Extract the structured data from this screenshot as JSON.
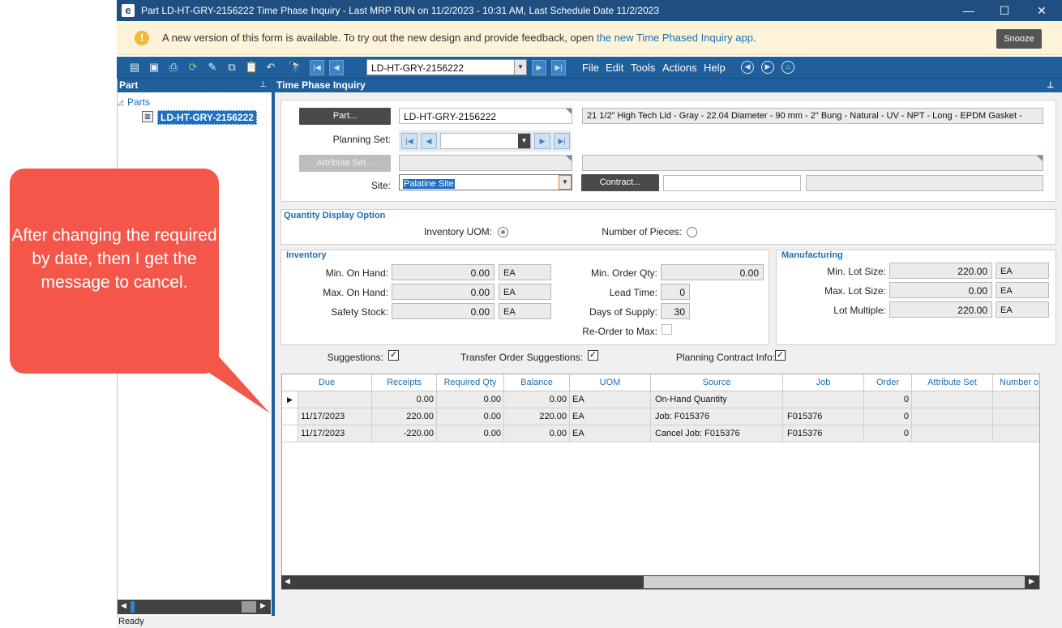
{
  "window": {
    "title": "Part LD-HT-GRY-2156222 Time Phase Inquiry  -  Last MRP RUN on 11/2/2023 - 10:31 AM, Last Schedule Date  11/2/2023",
    "logo": "e",
    "minimize": "—",
    "maximize": "☐",
    "close": "✕"
  },
  "notice": {
    "icon": "!",
    "text": "A new version of this form is available. To try out the new design and provide feedback, open ",
    "link": "the new Time Phased Inquiry app",
    "end": ".",
    "snooze": "Snooze"
  },
  "toolbar": {
    "part_value": "LD-HT-GRY-2156222",
    "menus": [
      "File",
      "Edit",
      "Tools",
      "Actions",
      "Help"
    ]
  },
  "left_panel": {
    "header": "Part",
    "tree_root": "Parts",
    "tree_node": "LD-HT-GRY-2156222"
  },
  "main": {
    "header": "Time Phase Inquiry",
    "part_button": "Part...",
    "part_value": "LD-HT-GRY-2156222",
    "part_description": "21 1/2\" High Tech Lid - Gray - 22.04 Diameter - 90 mm - 2\" Bung - Natural - UV - NPT - Long - EPDM Gasket -",
    "planning_set_label": "Planning Set:",
    "attribute_button": "Attribute Set...",
    "site_label": "Site:",
    "site_value": "Palatine Site",
    "contract_button": "Contract...",
    "qty_display": {
      "title": "Quantity Display Option",
      "inventory_uom": "Inventory UOM:",
      "number_of_pieces": "Number of Pieces:"
    },
    "inventory": {
      "title": "Inventory",
      "min_on_hand_label": "Min. On Hand:",
      "min_on_hand": "0.00",
      "min_on_hand_uom": "EA",
      "max_on_hand_label": "Max. On Hand:",
      "max_on_hand": "0.00",
      "max_on_hand_uom": "EA",
      "safety_stock_label": "Safety Stock:",
      "safety_stock": "0.00",
      "safety_stock_uom": "EA",
      "min_order_qty_label": "Min. Order Qty:",
      "min_order_qty": "0.00",
      "lead_time_label": "Lead Time:",
      "lead_time": "0",
      "days_supply_label": "Days of Supply:",
      "days_supply": "30",
      "reorder_label": "Re-Order to Max:"
    },
    "manufacturing": {
      "title": "Manufacturing",
      "min_lot_label": "Min. Lot Size:",
      "min_lot": "220.00",
      "min_lot_uom": "EA",
      "max_lot_label": "Max. Lot Size:",
      "max_lot": "0.00",
      "max_lot_uom": "EA",
      "lot_multiple_label": "Lot Multiple:",
      "lot_multiple": "220.00",
      "lot_multiple_uom": "EA"
    },
    "checks": {
      "suggestions": "Suggestions:",
      "transfer": "Transfer Order Suggestions:",
      "planning_contract": "Planning Contract Info:",
      "mark": "✓"
    },
    "grid": {
      "columns": [
        "Due",
        "Receipts",
        "Required Qty",
        "Balance",
        "UOM",
        "Source",
        "Job",
        "Order",
        "Attribute Set",
        "Number o"
      ],
      "rows": [
        [
          "",
          "0.00",
          "0.00",
          "0.00",
          "EA",
          "On-Hand Quantity",
          "",
          "0",
          "",
          ""
        ],
        [
          "11/17/2023",
          "220.00",
          "0.00",
          "220.00",
          "EA",
          "Job: F015376",
          "F015376",
          "0",
          "",
          ""
        ],
        [
          "11/17/2023",
          "-220.00",
          "0.00",
          "0.00",
          "EA",
          "Cancel Job: F015376",
          "F015376",
          "0",
          "",
          ""
        ]
      ]
    }
  },
  "status": "Ready",
  "callout": {
    "text": "After changing the required by date, then I get the message to cancel."
  },
  "colors": {
    "titlebar": "#1f4f80",
    "toolbar": "#1e5f9c",
    "callout": "#f5564a",
    "accent": "#1a6fb5"
  }
}
